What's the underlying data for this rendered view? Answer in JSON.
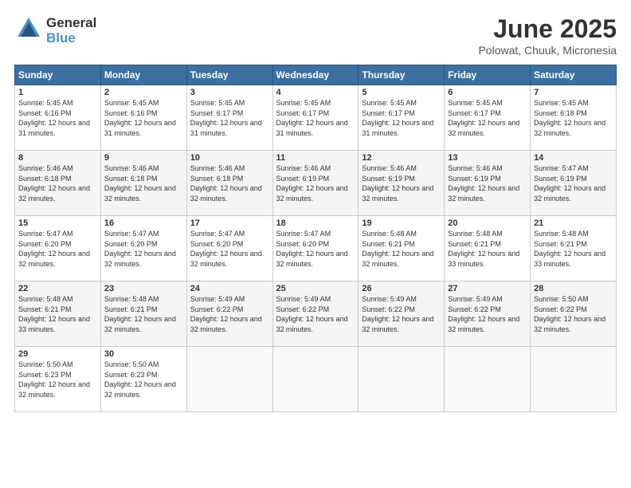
{
  "logo": {
    "general": "General",
    "blue": "Blue"
  },
  "title": "June 2025",
  "location": "Polowat, Chuuk, Micronesia",
  "weekdays": [
    "Sunday",
    "Monday",
    "Tuesday",
    "Wednesday",
    "Thursday",
    "Friday",
    "Saturday"
  ],
  "weeks": [
    [
      {
        "day": "1",
        "sunrise": "5:45 AM",
        "sunset": "6:16 PM",
        "daylight": "12 hours and 31 minutes."
      },
      {
        "day": "2",
        "sunrise": "5:45 AM",
        "sunset": "6:16 PM",
        "daylight": "12 hours and 31 minutes."
      },
      {
        "day": "3",
        "sunrise": "5:45 AM",
        "sunset": "6:17 PM",
        "daylight": "12 hours and 31 minutes."
      },
      {
        "day": "4",
        "sunrise": "5:45 AM",
        "sunset": "6:17 PM",
        "daylight": "12 hours and 31 minutes."
      },
      {
        "day": "5",
        "sunrise": "5:45 AM",
        "sunset": "6:17 PM",
        "daylight": "12 hours and 31 minutes."
      },
      {
        "day": "6",
        "sunrise": "5:45 AM",
        "sunset": "6:17 PM",
        "daylight": "12 hours and 32 minutes."
      },
      {
        "day": "7",
        "sunrise": "5:45 AM",
        "sunset": "6:18 PM",
        "daylight": "12 hours and 32 minutes."
      }
    ],
    [
      {
        "day": "8",
        "sunrise": "5:46 AM",
        "sunset": "6:18 PM",
        "daylight": "12 hours and 32 minutes."
      },
      {
        "day": "9",
        "sunrise": "5:46 AM",
        "sunset": "6:18 PM",
        "daylight": "12 hours and 32 minutes."
      },
      {
        "day": "10",
        "sunrise": "5:46 AM",
        "sunset": "6:18 PM",
        "daylight": "12 hours and 32 minutes."
      },
      {
        "day": "11",
        "sunrise": "5:46 AM",
        "sunset": "6:19 PM",
        "daylight": "12 hours and 32 minutes."
      },
      {
        "day": "12",
        "sunrise": "5:46 AM",
        "sunset": "6:19 PM",
        "daylight": "12 hours and 32 minutes."
      },
      {
        "day": "13",
        "sunrise": "5:46 AM",
        "sunset": "6:19 PM",
        "daylight": "12 hours and 32 minutes."
      },
      {
        "day": "14",
        "sunrise": "5:47 AM",
        "sunset": "6:19 PM",
        "daylight": "12 hours and 32 minutes."
      }
    ],
    [
      {
        "day": "15",
        "sunrise": "5:47 AM",
        "sunset": "6:20 PM",
        "daylight": "12 hours and 32 minutes."
      },
      {
        "day": "16",
        "sunrise": "5:47 AM",
        "sunset": "6:20 PM",
        "daylight": "12 hours and 32 minutes."
      },
      {
        "day": "17",
        "sunrise": "5:47 AM",
        "sunset": "6:20 PM",
        "daylight": "12 hours and 32 minutes."
      },
      {
        "day": "18",
        "sunrise": "5:47 AM",
        "sunset": "6:20 PM",
        "daylight": "12 hours and 32 minutes."
      },
      {
        "day": "19",
        "sunrise": "5:48 AM",
        "sunset": "6:21 PM",
        "daylight": "12 hours and 32 minutes."
      },
      {
        "day": "20",
        "sunrise": "5:48 AM",
        "sunset": "6:21 PM",
        "daylight": "12 hours and 33 minutes."
      },
      {
        "day": "21",
        "sunrise": "5:48 AM",
        "sunset": "6:21 PM",
        "daylight": "12 hours and 33 minutes."
      }
    ],
    [
      {
        "day": "22",
        "sunrise": "5:48 AM",
        "sunset": "6:21 PM",
        "daylight": "12 hours and 33 minutes."
      },
      {
        "day": "23",
        "sunrise": "5:48 AM",
        "sunset": "6:21 PM",
        "daylight": "12 hours and 32 minutes."
      },
      {
        "day": "24",
        "sunrise": "5:49 AM",
        "sunset": "6:22 PM",
        "daylight": "12 hours and 32 minutes."
      },
      {
        "day": "25",
        "sunrise": "5:49 AM",
        "sunset": "6:22 PM",
        "daylight": "12 hours and 32 minutes."
      },
      {
        "day": "26",
        "sunrise": "5:49 AM",
        "sunset": "6:22 PM",
        "daylight": "12 hours and 32 minutes."
      },
      {
        "day": "27",
        "sunrise": "5:49 AM",
        "sunset": "6:22 PM",
        "daylight": "12 hours and 32 minutes."
      },
      {
        "day": "28",
        "sunrise": "5:50 AM",
        "sunset": "6:22 PM",
        "daylight": "12 hours and 32 minutes."
      }
    ],
    [
      {
        "day": "29",
        "sunrise": "5:50 AM",
        "sunset": "6:23 PM",
        "daylight": "12 hours and 32 minutes."
      },
      {
        "day": "30",
        "sunrise": "5:50 AM",
        "sunset": "6:23 PM",
        "daylight": "12 hours and 32 minutes."
      },
      null,
      null,
      null,
      null,
      null
    ]
  ]
}
